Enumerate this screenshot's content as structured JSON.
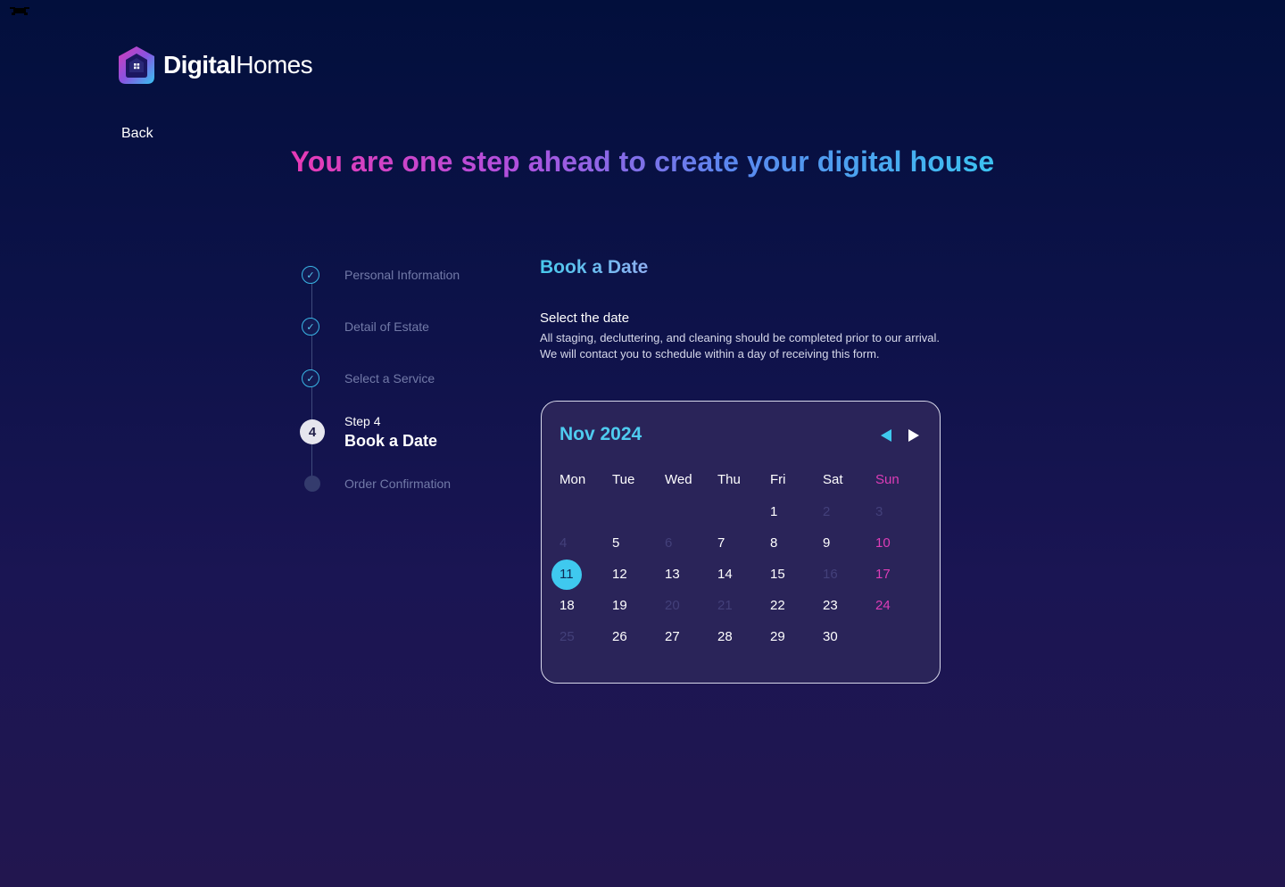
{
  "brand": {
    "name_bold": "Digital",
    "name_light": "Homes"
  },
  "nav": {
    "back_label": "Back"
  },
  "headline": "You are one step ahead to create your digital house",
  "stepper": {
    "steps": [
      {
        "label": "Personal Information",
        "state": "done"
      },
      {
        "label": "Detail of Estate",
        "state": "done"
      },
      {
        "label": "Select a Service",
        "state": "done"
      },
      {
        "number": "4",
        "sub": "Step 4",
        "label": "Book a Date",
        "state": "active"
      },
      {
        "label": "Order Confirmation",
        "state": "pending"
      }
    ],
    "check_glyph": "✓"
  },
  "booking": {
    "title": "Book a Date",
    "select_label": "Select the date",
    "description_line1": "All staging, decluttering, and cleaning should be completed prior to our arrival.",
    "description_line2": "We will contact you to schedule within a day of receiving this form."
  },
  "calendar": {
    "month_label": "Nov 2024",
    "weekdays": [
      "Mon",
      "Tue",
      "Wed",
      "Thu",
      "Fri",
      "Sat",
      "Sun"
    ],
    "weeks": [
      [
        null,
        null,
        null,
        null,
        {
          "d": "1"
        },
        {
          "d": "2",
          "muted": true
        },
        {
          "d": "3",
          "muted": true
        }
      ],
      [
        {
          "d": "4",
          "muted": true
        },
        {
          "d": "5"
        },
        {
          "d": "6",
          "muted": true
        },
        {
          "d": "7"
        },
        {
          "d": "8"
        },
        {
          "d": "9"
        },
        {
          "d": "10"
        }
      ],
      [
        {
          "d": "11",
          "selected": true
        },
        {
          "d": "12"
        },
        {
          "d": "13"
        },
        {
          "d": "14"
        },
        {
          "d": "15"
        },
        {
          "d": "16",
          "muted": true
        },
        {
          "d": "17"
        }
      ],
      [
        {
          "d": "18"
        },
        {
          "d": "19"
        },
        {
          "d": "20",
          "muted": true
        },
        {
          "d": "21",
          "muted": true
        },
        {
          "d": "22"
        },
        {
          "d": "23"
        },
        {
          "d": "24"
        }
      ],
      [
        {
          "d": "25",
          "muted": true
        },
        {
          "d": "26"
        },
        {
          "d": "27"
        },
        {
          "d": "28"
        },
        {
          "d": "29"
        },
        {
          "d": "30"
        },
        null
      ]
    ],
    "selected_day": "11",
    "icons": {
      "prev": "triangle-left-icon",
      "next": "triangle-right-icon"
    },
    "colors": {
      "accent": "#3fc9ef",
      "weekend": "#dd3db7",
      "muted": "#43407a"
    }
  }
}
